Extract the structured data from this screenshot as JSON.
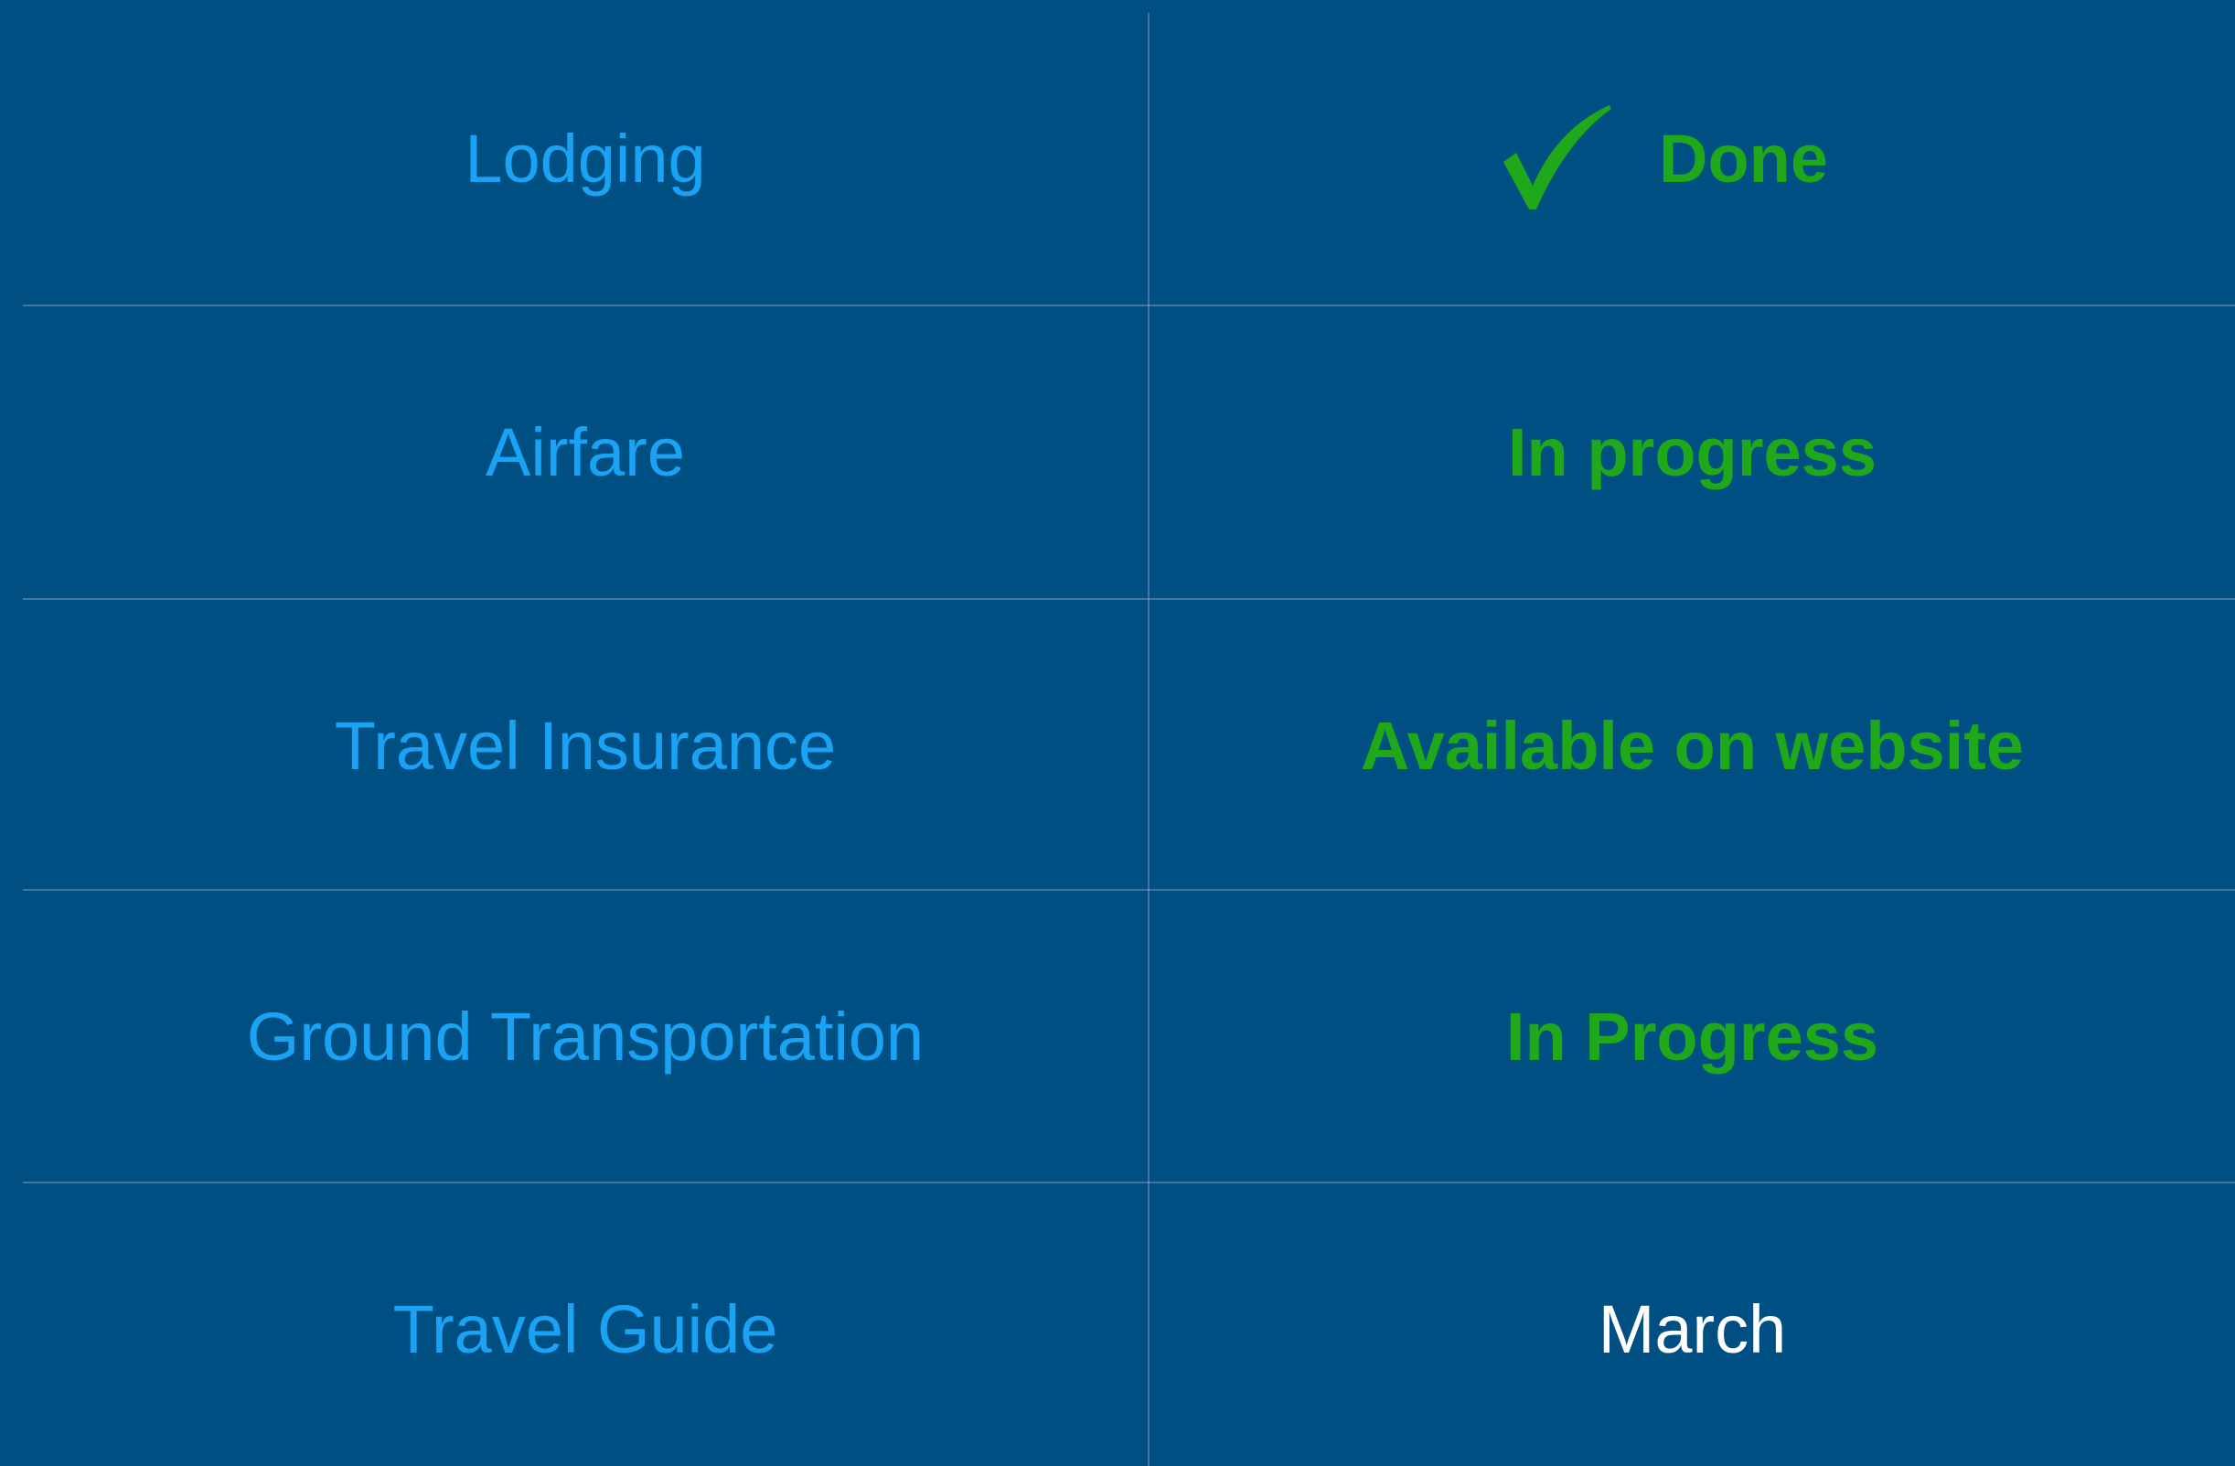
{
  "rows": [
    {
      "item": "Lodging",
      "status": "Done",
      "icon": "check-icon",
      "status_color": "#1fa81a"
    },
    {
      "item": "Airfare",
      "status": "In progress",
      "status_color": "#1fa81a"
    },
    {
      "item": "Travel Insurance",
      "status": "Available on website",
      "status_color": "#1fa81a"
    },
    {
      "item": "Ground Transportation",
      "status": "In Progress",
      "status_color": "#1fa81a"
    },
    {
      "item": "Travel Guide",
      "status": "March",
      "status_color": "#ffffff"
    }
  ],
  "colors": {
    "background": "#004f82",
    "item_text": "#1aa3f5",
    "done_green": "#1fa81a",
    "plain_text": "#ffffff"
  }
}
